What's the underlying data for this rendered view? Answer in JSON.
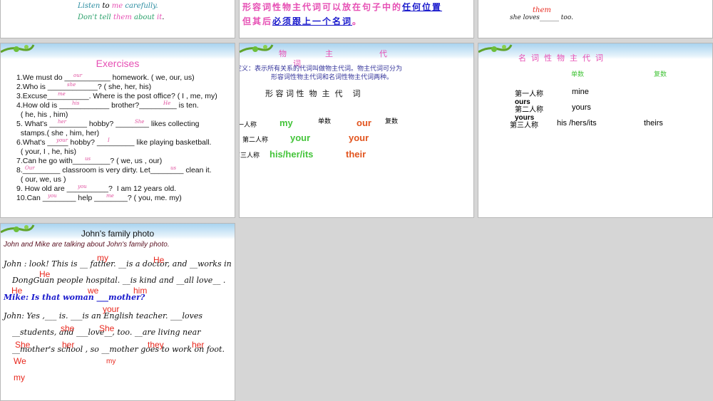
{
  "slide1": {
    "line1": [
      "Listen",
      " to ",
      "me",
      " carefully."
    ],
    "line2": [
      "Don't tell ",
      "them",
      " about ",
      "it",
      "."
    ]
  },
  "slide2": {
    "line1a": "形容词性物主代词可以放在句子中的",
    "line1b": "任何位置",
    "line2a": "但其后",
    "line2b": "必须跟上一个名词",
    "line2c": "。"
  },
  "slide3": {
    "answer": "them",
    "text": "she loves",
    "blank": "______",
    "end": " too."
  },
  "exercises": {
    "title": "Exercises",
    "lines": [
      "1.We must do ___________ homework. ( we, our, us)",
      "2.Who is ____________? ( she, her, his)",
      "3.Excuse__________. Where is the post office? ( I , me, my)",
      "4.How old is ____________ brother?_________ is ten.",
      "  ( he, his , him)",
      "5. What's _________ hobby? ________ likes collecting",
      "  stamps.( she , him, her)",
      "6.What's _____ hobby? _________ like playing basketball.",
      "  ( your, I , he, his)",
      "7.Can he go with_________? ( we, us , our)",
      "8._________ classroom is very dirty. Let________ clean it.",
      "  ( our, we, us )",
      "9. How old are __________?  I am 12 years old.",
      "10.Can ________ help ________? ( you, me. my)"
    ],
    "answers": [
      "our",
      "she",
      "me",
      "his",
      "He",
      "her",
      "She",
      "your",
      "I",
      "us",
      "Our",
      "us",
      "you",
      "you",
      "me"
    ]
  },
  "possessive": {
    "title_chars": [
      "物",
      "主",
      "代",
      "词"
    ],
    "definition1": "定义：表示所有关系的代词叫做物主代词。物主代词可分为",
    "definition2": "形容词性物主代词和名词性物主代词两种。",
    "subtitle": "形 容 词 性  物  主  代    词",
    "singular": "单数",
    "plural": "复数",
    "rows": [
      {
        "person": "第一人称",
        "sg": "my",
        "pl": "our"
      },
      {
        "person": "第二人称",
        "sg": "your",
        "pl": "your"
      },
      {
        "person": "第三人称",
        "sg": "his/her/its",
        "pl": "their"
      }
    ]
  },
  "noun_possessive": {
    "title": "名  词  性  物  主  代  词",
    "singular": "单数",
    "plural": "复数",
    "rows": [
      {
        "person": "第一人称",
        "sg": "mine",
        "pl": "ours"
      },
      {
        "person": "第二人称",
        "sg": "yours",
        "pl": "yours"
      },
      {
        "person": "第三人称",
        "sg": "his /hers/its",
        "pl": "theirs"
      }
    ]
  },
  "family": {
    "title": "John's family photo",
    "intro": "John and Mike are talking about John's family photo.",
    "lines": [
      "John : look! This is __ father. __is a doctor, and __works in",
      "DongGuan people hospital. __is kind and __all love__ .",
      "Mike: Is that woman ___mother?",
      "John: Yes ,___ is. ___is an English teacher. ___loves",
      "__students, and ___love__, too. __are living near",
      "__mother's school , so __mother goes to work on foot."
    ],
    "answers": [
      "my",
      "He",
      "He",
      "He",
      "we",
      "him",
      "your",
      "she",
      "She",
      "She",
      "her",
      "they",
      "her",
      "We",
      "my",
      "my"
    ]
  },
  "colors": {
    "pink": "#e64fb4",
    "green": "#44c43a",
    "orange": "#e2551f",
    "red": "#e8281e",
    "blue": "#1a1acc"
  }
}
